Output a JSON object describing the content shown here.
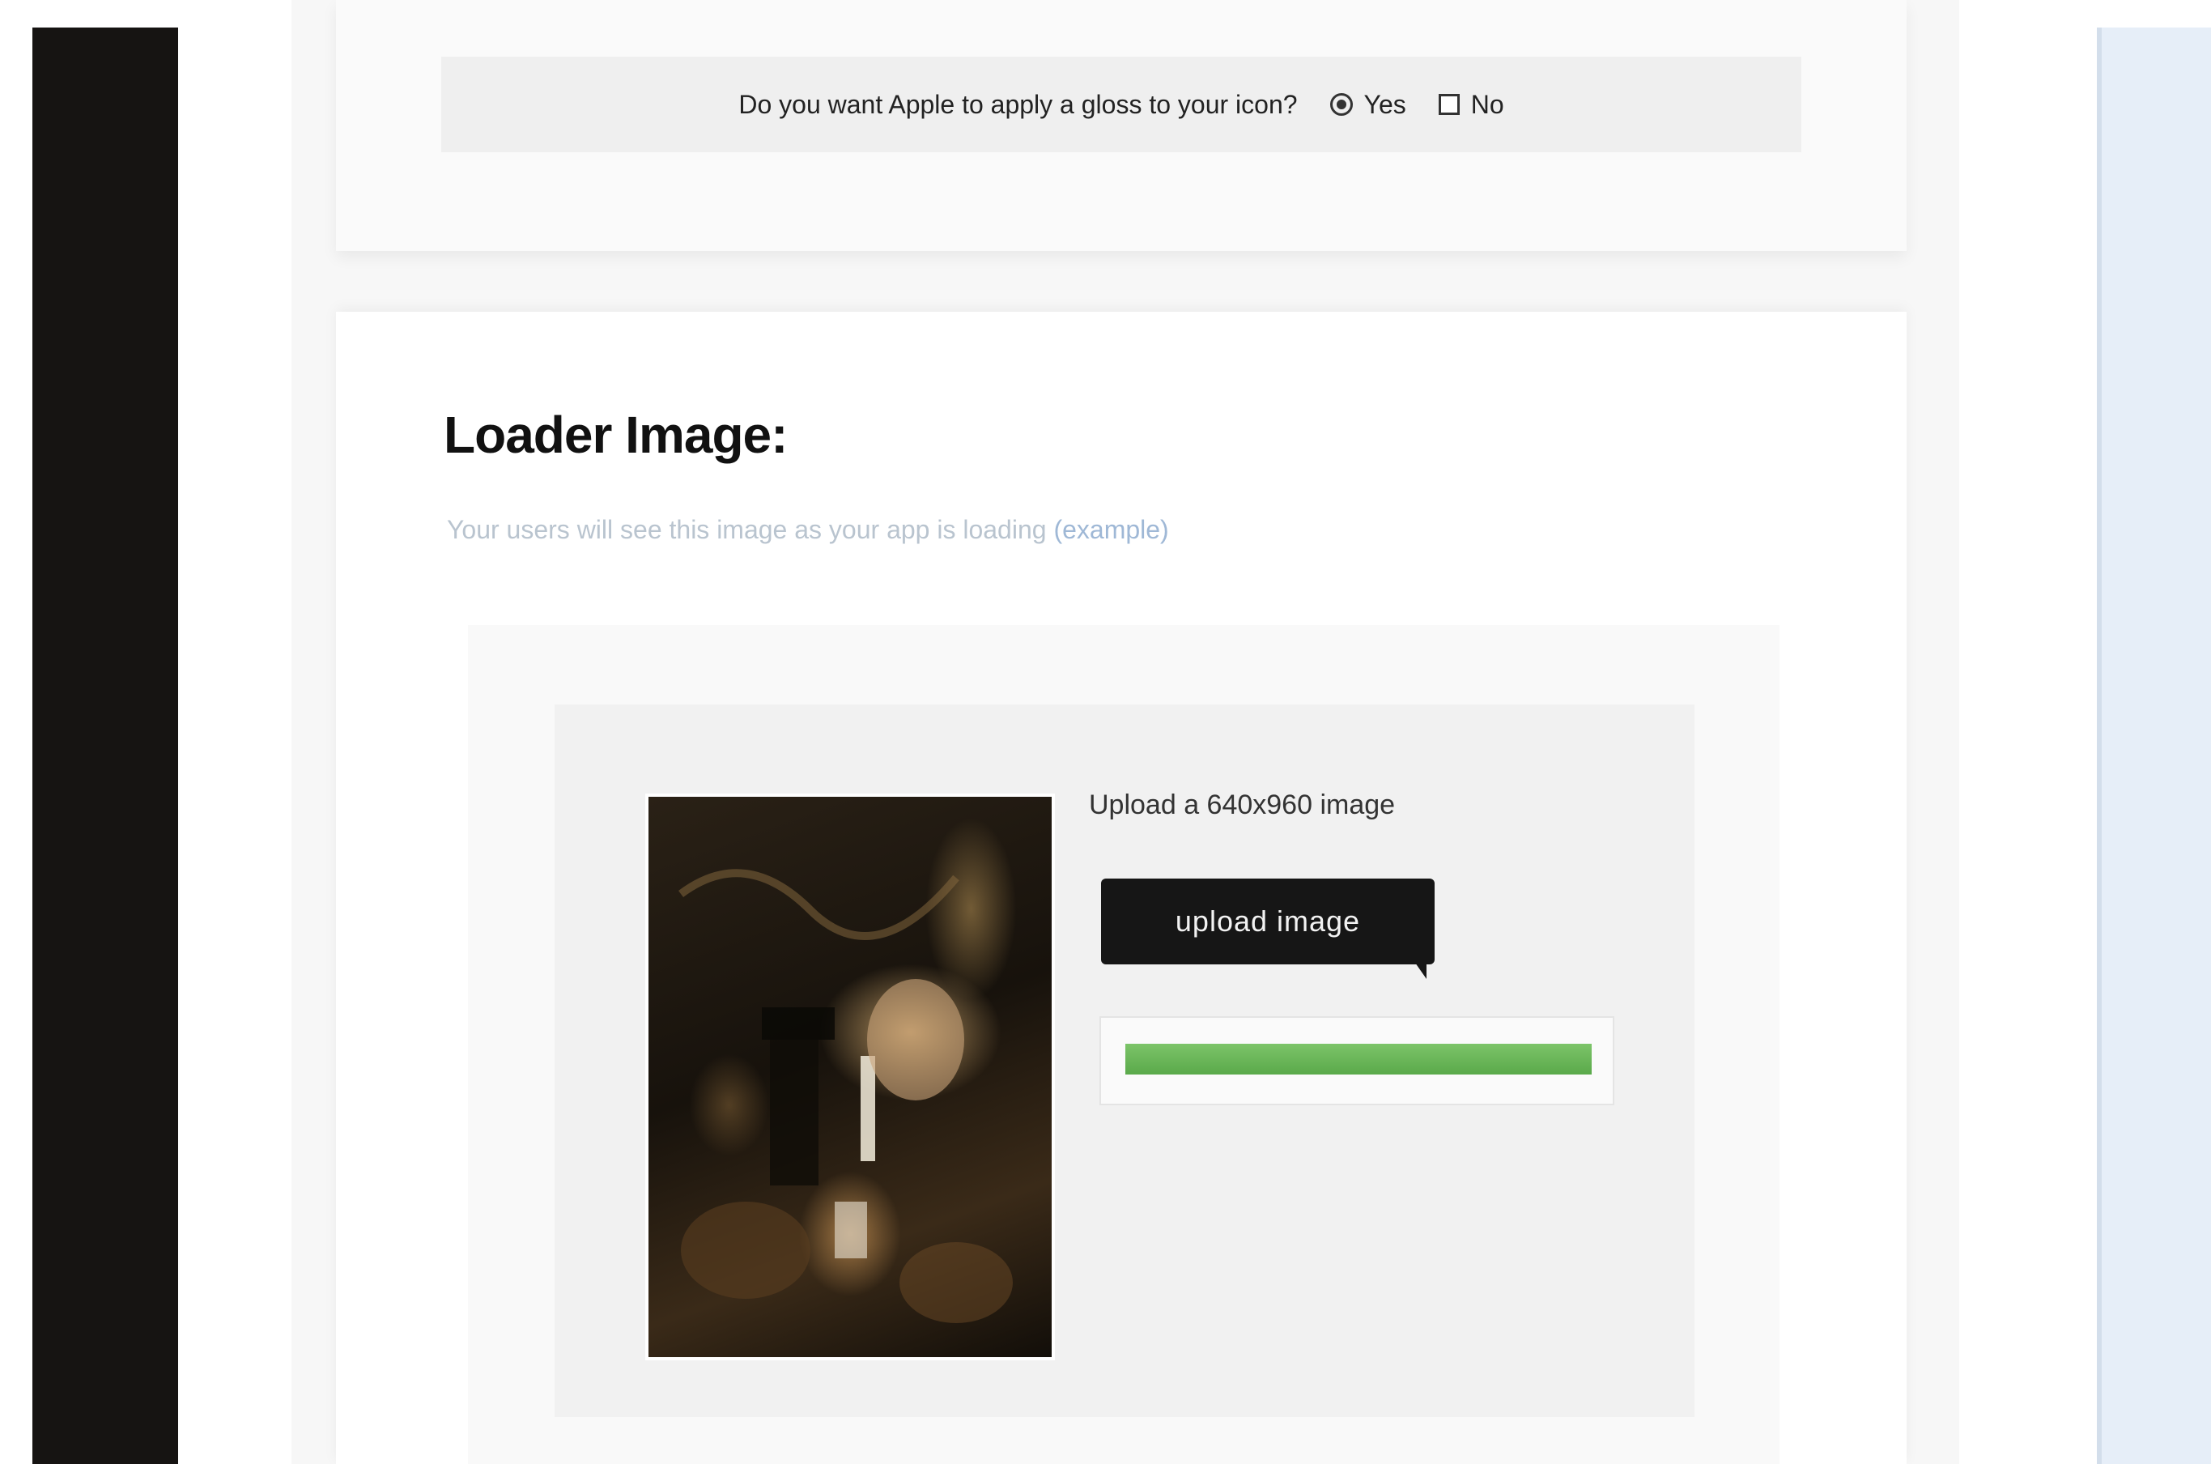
{
  "question": {
    "text": "Do you want Apple to apply a gloss to your icon?",
    "options": [
      {
        "label": "Yes",
        "selected": true
      },
      {
        "label": "No",
        "selected": false
      }
    ]
  },
  "loader": {
    "title": "Loader Image:",
    "description": "Your users will see this image as your app is loading",
    "description_link": "(example)",
    "upload_label": "Upload a 640x960 image",
    "upload_button": "upload image",
    "progress": 1.0
  },
  "colors": {
    "progress": "#5aa94a",
    "button": "#161616",
    "sidebar": "#161412"
  }
}
